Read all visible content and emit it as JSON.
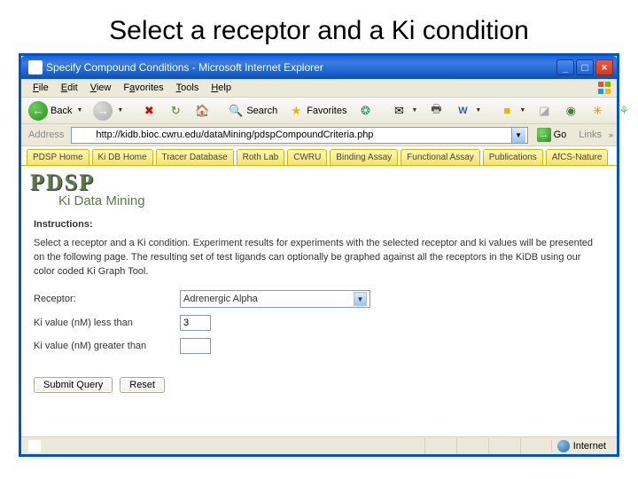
{
  "slide_title": "Select a receptor and a Ki condition",
  "window": {
    "title": "Specify Compound Conditions - Microsoft Internet Explorer",
    "min": "_",
    "max": "□",
    "close": "×"
  },
  "menu": {
    "file": "File",
    "edit": "Edit",
    "view": "View",
    "favorites": "Favorites",
    "tools": "Tools",
    "help": "Help"
  },
  "toolbar": {
    "back": "Back",
    "search": "Search",
    "favorites": "Favorites"
  },
  "addr": {
    "label": "Address",
    "url": "http://kidb.bioc.cwru.edu/dataMining/pdspCompoundCriteria.php",
    "go": "Go",
    "links": "Links"
  },
  "tabs": {
    "t0": "PDSP Home",
    "t1": "Ki DB Home",
    "t2": "Tracer Database",
    "t3": "Roth Lab",
    "t4": "CWRU",
    "t5": "Binding Assay",
    "t6": "Functional Assay",
    "t7": "Publications",
    "t8": "AfCS-Nature"
  },
  "logo": {
    "main": "PDSP",
    "sub": "Ki Data Mining"
  },
  "form": {
    "instructions_heading": "Instructions:",
    "instructions_body": "Select a receptor and a Ki condition. Experiment results for experiments with the selected receptor and ki values will be presented on the following page. The resulting set of test ligands can optionally be graphed against all the receptors in the KiDB using our color coded Ki Graph Tool.",
    "receptor_label": "Receptor:",
    "receptor_value": "Adrenergic Alpha",
    "ki_less_label": "Ki value (nM) less than",
    "ki_less_value": "3",
    "ki_greater_label": "Ki value (nM) greater than",
    "ki_greater_value": "",
    "submit": "Submit Query",
    "reset": "Reset"
  },
  "status": {
    "zone": "Internet"
  }
}
